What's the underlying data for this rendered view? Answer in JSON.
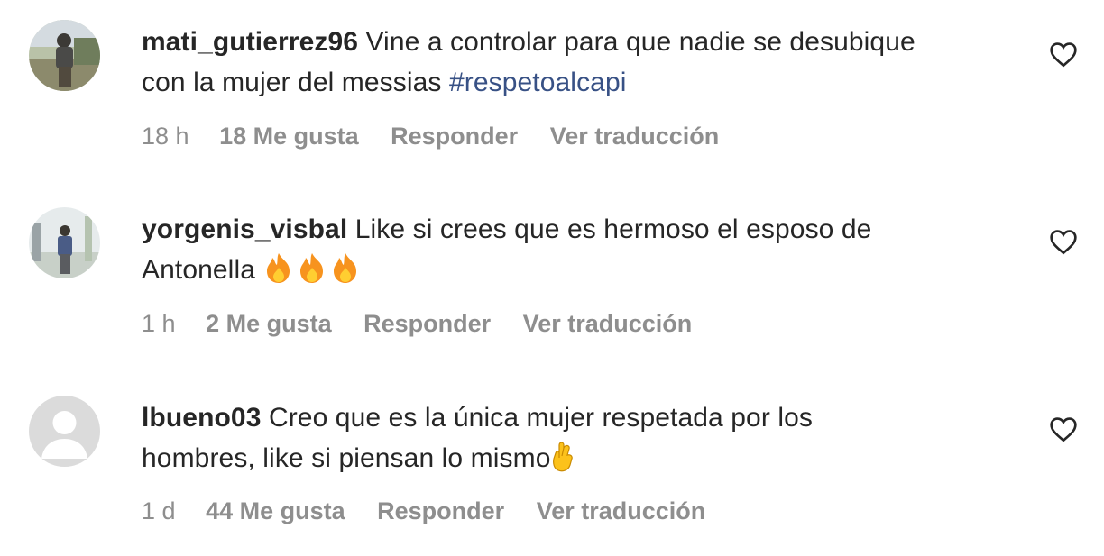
{
  "comments": [
    {
      "avatar_icon": "user-photo-avatar",
      "username": "mati_gutierrez96",
      "text_line1": "Vine a controlar para que nadie se desubique",
      "text_line2": "con la mujer del messias ",
      "hashtag": "#respetoalcapi",
      "time": "18 h",
      "likes": "18 Me gusta",
      "reply": "Responder",
      "translate": "Ver traducción"
    },
    {
      "avatar_icon": "user-photo-avatar",
      "username": "yorgenis_visbal",
      "text_line1": "Like si crees que es hermoso el esposo de",
      "text_line2": "Antonella ",
      "emoji": "fire-emoji",
      "time": "1 h",
      "likes": "2 Me gusta",
      "reply": "Responder",
      "translate": "Ver traducción"
    },
    {
      "avatar_icon": "default-avatar",
      "username": "lbueno03",
      "text_line1": "Creo que es la única mujer respetada por los",
      "text_line2": "hombres, like si piensan lo mismo",
      "emoji": "crossed-fingers-emoji",
      "time": "1 d",
      "likes": "44 Me gusta",
      "reply": "Responder",
      "translate": "Ver traducción"
    }
  ],
  "colors": {
    "text": "#262626",
    "meta": "#8e8e8e",
    "hashtag": "#385185"
  }
}
